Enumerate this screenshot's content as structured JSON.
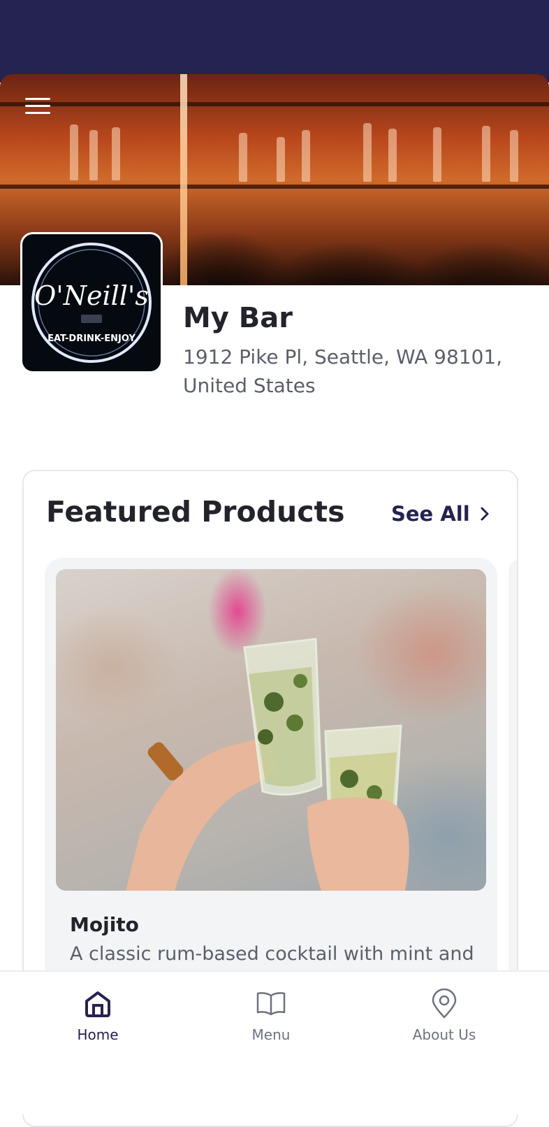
{
  "bar": {
    "name": "My Bar",
    "address": "1912 Pike Pl, Seattle, WA 98101, United States",
    "logo_text": "O'Neill's",
    "logo_tagline": "EAT-DRINK-ENJOY"
  },
  "featured": {
    "title": "Featured Products",
    "see_all": "See All",
    "products": [
      {
        "name": "Mojito",
        "description": "A classic rum-based cocktail with mint and"
      }
    ]
  },
  "nav": {
    "items": [
      {
        "label": "Home",
        "icon": "home-icon",
        "active": true
      },
      {
        "label": "Menu",
        "icon": "book-icon",
        "active": false
      },
      {
        "label": "About Us",
        "icon": "map-pin-icon",
        "active": false
      }
    ]
  },
  "colors": {
    "brand": "#25234f",
    "text": "#22232b",
    "muted": "#5a5f6a",
    "card_bg": "#f3f4f6"
  }
}
